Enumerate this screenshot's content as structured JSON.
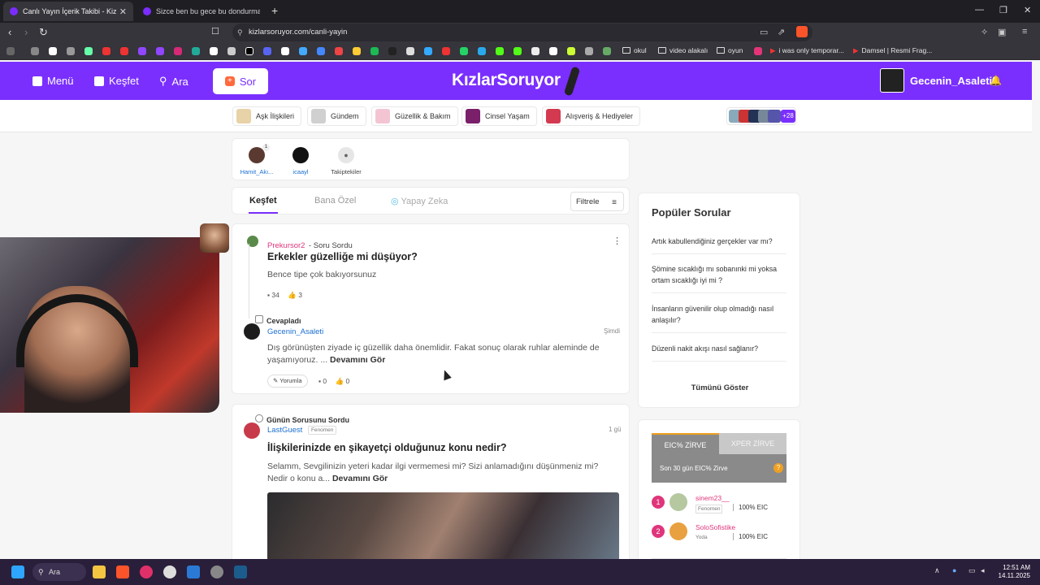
{
  "browser": {
    "tabs": [
      {
        "title": "Canlı Yayın İçerik Takibi - KizlarSoruyor",
        "active": true
      },
      {
        "title": "Sizce ben bu gece bu dondurmayı bi...",
        "active": false
      }
    ],
    "url": "kizlarsoruyor.com/canli-yayin",
    "bookmarks": [
      "okul",
      "video alakalı",
      "oyun",
      "i was only temporar...",
      "Damsel | Resmi Frag..."
    ]
  },
  "header": {
    "menu_label": "Menü",
    "explore_label": "Keşfet",
    "search_label": "Ara",
    "ask_label": "Sor",
    "logo": "KızlarSoruyor",
    "username": "Gecenin_Asaleti"
  },
  "categories": [
    {
      "label": "Aşk İlişkileri",
      "color": "#e8d2a8"
    },
    {
      "label": "Gündem",
      "color": "#d0d0d0"
    },
    {
      "label": "Güzellik & Bakım",
      "color": "#f3c5d2"
    },
    {
      "label": "Cinsel Yaşam",
      "color": "#7a1f6a"
    },
    {
      "label": "Alışveriş & Hediyeler",
      "color": "#d33a4f"
    }
  ],
  "categories_more": "+28",
  "following": [
    {
      "name": "Hamit_Akı...",
      "badge": "1"
    },
    {
      "name": "icaayl"
    },
    {
      "name": "Takiptekiler"
    }
  ],
  "feed_tabs": {
    "explore": "Keşfet",
    "private": "Bana Özel",
    "ai": "Yapay Zeka",
    "filter": "Filtrele"
  },
  "post1": {
    "user": "Prekursor2",
    "action": "Soru Sordu",
    "title": "Erkekler güzelliğe mi düşüyor?",
    "body": "Bence tipe çok bakıyorsunuz",
    "comments": "34",
    "likes": "3",
    "reply_label": "Cevapladı",
    "reply_user": "Gecenin_Asaleti",
    "reply_time": "Şimdi",
    "reply_body": "Dış görünüşten ziyade iç güzellik daha önemlidir. Fakat sonuç olarak ruhlar aleminde de yaşamıyoruz. ...",
    "read_more": "Devamını Gör",
    "comment_btn": "Yorumla",
    "reply_comments": "0",
    "reply_likes": "0"
  },
  "post2": {
    "action": "Günün Sorusunu Sordu",
    "user": "LastGuest",
    "role": "Fenomen",
    "time": "1 gü",
    "title": "İlişkilerinizde en şikayetçi olduğunuz konu nedir?",
    "body": "Selamm, Sevgilinizin yeteri kadar ilgi vermemesi mi? Sizi anlamadığını düşünmeniz mi? Nedir o konu a...",
    "read_more": "Devamını Gör"
  },
  "sidebar": {
    "popular_title": "Popüler Sorular",
    "popular": [
      "Artık kabullendiğiniz gerçekler var mı?",
      "Şömine sıcaklığı mı sobanınki mi yoksa ortam sıcaklığı iyi mi ?",
      "İnsanların güvenilir olup olmadığı nasıl anlaşılır?",
      "Düzenli nakit akışı nasıl sağlanır?"
    ],
    "show_all": "Tümünü Göster",
    "zirve_tabs": [
      "EIC% ZİRVE",
      "XPER ZİRVE"
    ],
    "zirve_sub": "Son 30 gün EIC% Zirve",
    "ranking": [
      {
        "rank": "1",
        "name": "sinem23__",
        "role": "Fenomen",
        "value": "100% EIC"
      },
      {
        "rank": "2",
        "name": "SoloSofistike",
        "role": "Yoda",
        "value": "100% EIC"
      }
    ]
  },
  "taskbar": {
    "search": "Ara",
    "time": "12:51 AM",
    "date": "14.11.2025"
  },
  "colors": {
    "brand": "#7a2fff",
    "accent_pink": "#e0357a"
  }
}
